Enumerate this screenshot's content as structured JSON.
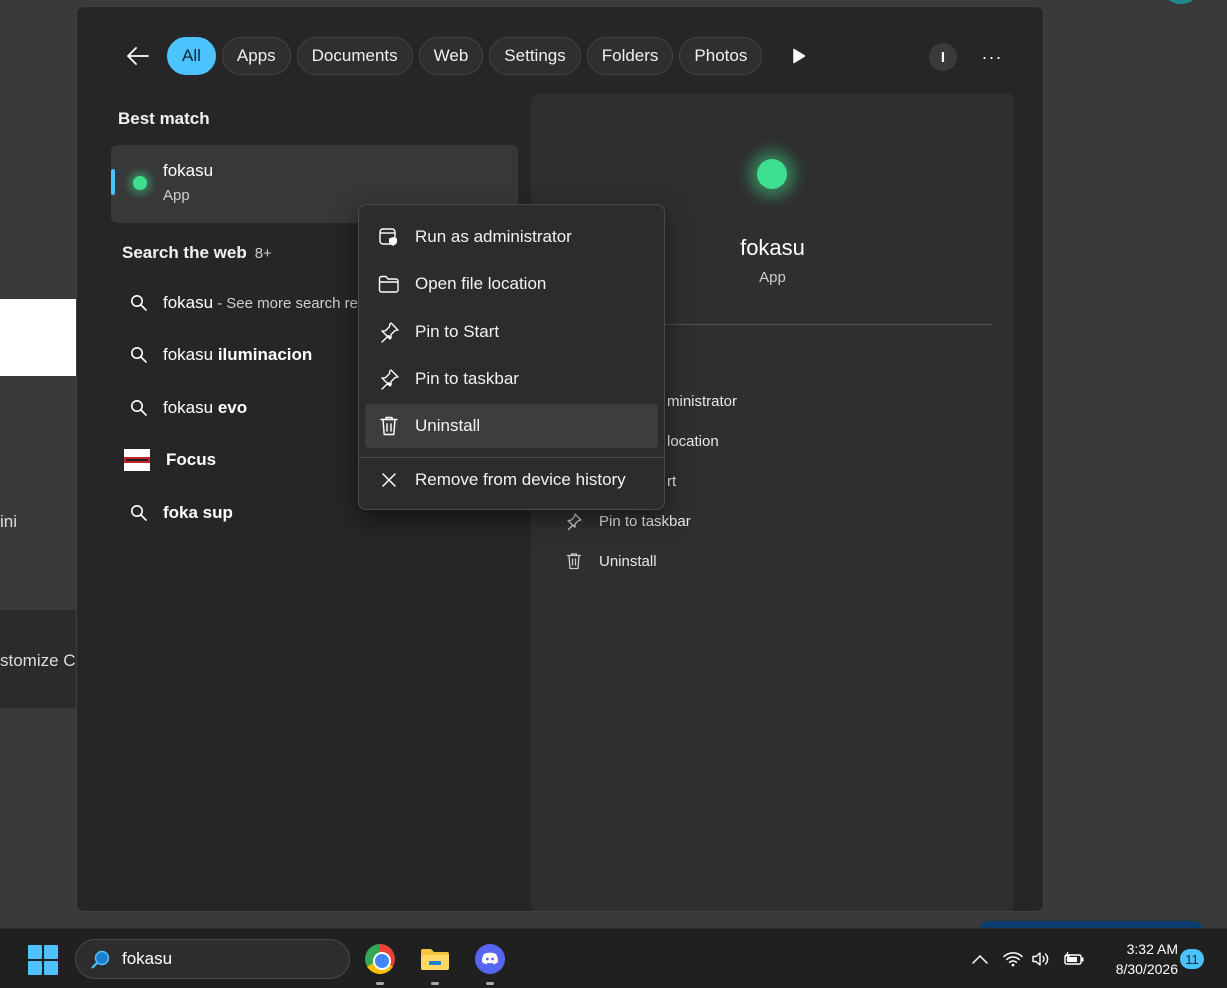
{
  "background": {
    "fragment_text_1": "ini",
    "fragment_text_2": "stomize C"
  },
  "filters": {
    "tabs": [
      {
        "label": "All",
        "active": true
      },
      {
        "label": "Apps"
      },
      {
        "label": "Documents"
      },
      {
        "label": "Web"
      },
      {
        "label": "Settings"
      },
      {
        "label": "Folders"
      },
      {
        "label": "Photos"
      }
    ],
    "avatar_letter": "I",
    "more": "···"
  },
  "best_match": {
    "title": "Best match",
    "name": "fokasu",
    "type": "App"
  },
  "search_web": {
    "title": "Search the web",
    "count": "8+",
    "items": [
      {
        "main": "fokasu",
        "sub": " - See more search re"
      },
      {
        "prefix": "fokasu ",
        "bold": "iluminacion"
      },
      {
        "prefix": "fokasu ",
        "bold": "evo"
      },
      {
        "bold": "Focus"
      },
      {
        "bold": "foka sup"
      }
    ]
  },
  "detail": {
    "name": "fokasu",
    "type": "App",
    "actions": [
      {
        "label": "ministrator",
        "icon": "shield-icon"
      },
      {
        "label": "location",
        "icon": "folder-icon"
      },
      {
        "label": "rt",
        "icon": "pin-icon"
      },
      {
        "label": "Pin to taskbar",
        "icon": "pin-icon"
      },
      {
        "label": "Uninstall",
        "icon": "trash-icon"
      }
    ]
  },
  "context_menu": {
    "items": [
      {
        "label": "Run as administrator",
        "icon": "admin-shield-icon"
      },
      {
        "label": "Open file location",
        "icon": "folder-open-icon"
      },
      {
        "label": "Pin to Start",
        "icon": "pin-icon"
      },
      {
        "label": "Pin to taskbar",
        "icon": "pin-icon"
      },
      {
        "label": "Uninstall",
        "icon": "trash-icon",
        "hovered": true
      },
      {
        "label": "Remove from device history",
        "icon": "close-icon"
      }
    ]
  },
  "taskbar": {
    "search_value": "fokasu",
    "time": "3:32 AM",
    "date": "8/30/2026",
    "notification_count": "11",
    "apps": [
      "chrome-icon",
      "file-explorer-icon",
      "discord-icon"
    ]
  },
  "colors": {
    "accent": "#4cc2ff",
    "app_icon": "#3ee08f"
  }
}
